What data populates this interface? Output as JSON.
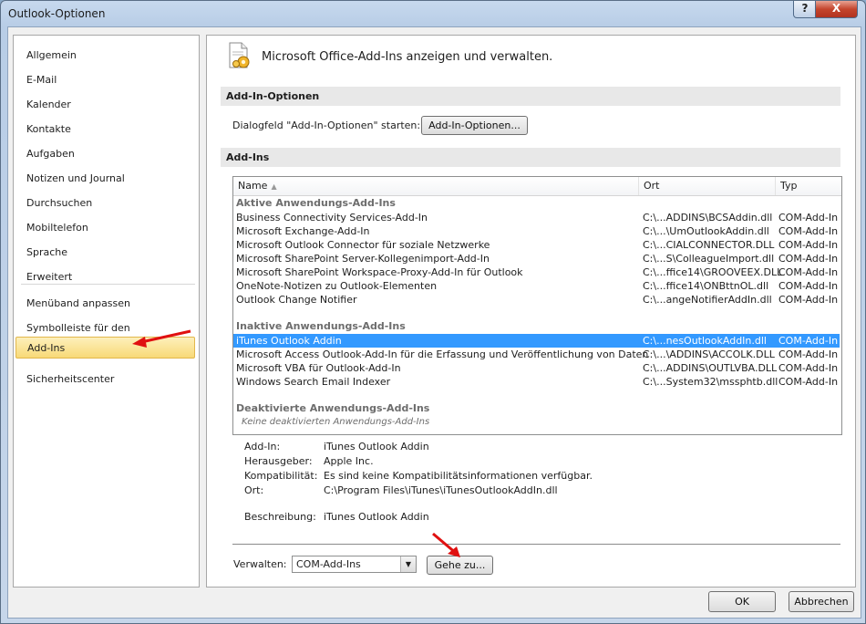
{
  "window": {
    "title": "Outlook-Optionen",
    "help_glyph": "?",
    "close_glyph": "X"
  },
  "nav": {
    "group1": [
      "Allgemein",
      "E-Mail",
      "Kalender",
      "Kontakte",
      "Aufgaben",
      "Notizen und Journal",
      "Durchsuchen",
      "Mobiltelefon",
      "Sprache",
      "Erweitert"
    ],
    "group2": [
      "Menüband anpassen",
      "Symbolleiste für den Schnellzugriff",
      "Add-Ins",
      "Sicherheitscenter"
    ],
    "selected": "Add-Ins"
  },
  "main": {
    "header": "Microsoft Office-Add-Ins anzeigen und verwalten.",
    "options_section": "Add-In-Optionen",
    "options_label": "Dialogfeld \"Add-In-Optionen\" starten:",
    "options_button": "Add-In-Optionen...",
    "addins_section": "Add-Ins",
    "columns": {
      "name": "Name",
      "ort": "Ort",
      "typ": "Typ"
    },
    "groups": [
      {
        "title": "Aktive Anwendungs-Add-Ins",
        "rows": [
          {
            "name": "Business Connectivity Services-Add-In",
            "ort": "C:\\...ADDINS\\BCSAddin.dll",
            "typ": "COM-Add-In"
          },
          {
            "name": "Microsoft Exchange-Add-In",
            "ort": "C:\\...\\UmOutlookAddin.dll",
            "typ": "COM-Add-In"
          },
          {
            "name": "Microsoft Outlook Connector für soziale Netzwerke",
            "ort": "C:\\...CIALCONNECTOR.DLL",
            "typ": "COM-Add-In"
          },
          {
            "name": "Microsoft SharePoint Server-Kollegenimport-Add-In",
            "ort": "C:\\...S\\ColleagueImport.dll",
            "typ": "COM-Add-In"
          },
          {
            "name": "Microsoft SharePoint Workspace-Proxy-Add-In für Outlook",
            "ort": "C:\\...ffice14\\GROOVEEX.DLL",
            "typ": "COM-Add-In"
          },
          {
            "name": "OneNote-Notizen zu Outlook-Elementen",
            "ort": "C:\\...ffice14\\ONBttnOL.dll",
            "typ": "COM-Add-In"
          },
          {
            "name": "Outlook Change Notifier",
            "ort": "C:\\...angeNotifierAddIn.dll",
            "typ": "COM-Add-In"
          }
        ]
      },
      {
        "title": "Inaktive Anwendungs-Add-Ins",
        "rows": [
          {
            "name": "iTunes Outlook Addin",
            "ort": "C:\\...nesOutlookAddIn.dll",
            "typ": "COM-Add-In"
          },
          {
            "name": "Microsoft Access Outlook-Add-In für die Erfassung und Veröffentlichung von Daten",
            "ort": "C:\\...\\ADDINS\\ACCOLK.DLL",
            "typ": "COM-Add-In"
          },
          {
            "name": "Microsoft VBA für Outlook-Add-In",
            "ort": "C:\\...ADDINS\\OUTLVBA.DLL",
            "typ": "COM-Add-In"
          },
          {
            "name": "Windows Search Email Indexer",
            "ort": "C:\\...System32\\mssphtb.dll",
            "typ": "COM-Add-In"
          }
        ]
      },
      {
        "title": "Deaktivierte Anwendungs-Add-Ins",
        "empty": "Keine deaktivierten Anwendungs-Add-Ins"
      }
    ],
    "details": {
      "addin_label": "Add-In:",
      "addin": "iTunes Outlook Addin",
      "publisher_label": "Herausgeber:",
      "publisher": "Apple Inc.",
      "compat_label": "Kompatibilität:",
      "compat": "Es sind keine Kompatibilitätsinformationen verfügbar.",
      "location_label": "Ort:",
      "location": "C:\\Program Files\\iTunes\\iTunesOutlookAddIn.dll",
      "desc_label": "Beschreibung:",
      "desc": "iTunes Outlook Addin"
    },
    "manage_label": "Verwalten:",
    "manage_value": "COM-Add-Ins",
    "go_button": "Gehe zu..."
  },
  "footer": {
    "ok": "OK",
    "cancel": "Abbrechen"
  },
  "colors": {
    "selection": "#3399ff",
    "nav_selected": "#f8d977",
    "annotation_arrow": "#e01010"
  }
}
